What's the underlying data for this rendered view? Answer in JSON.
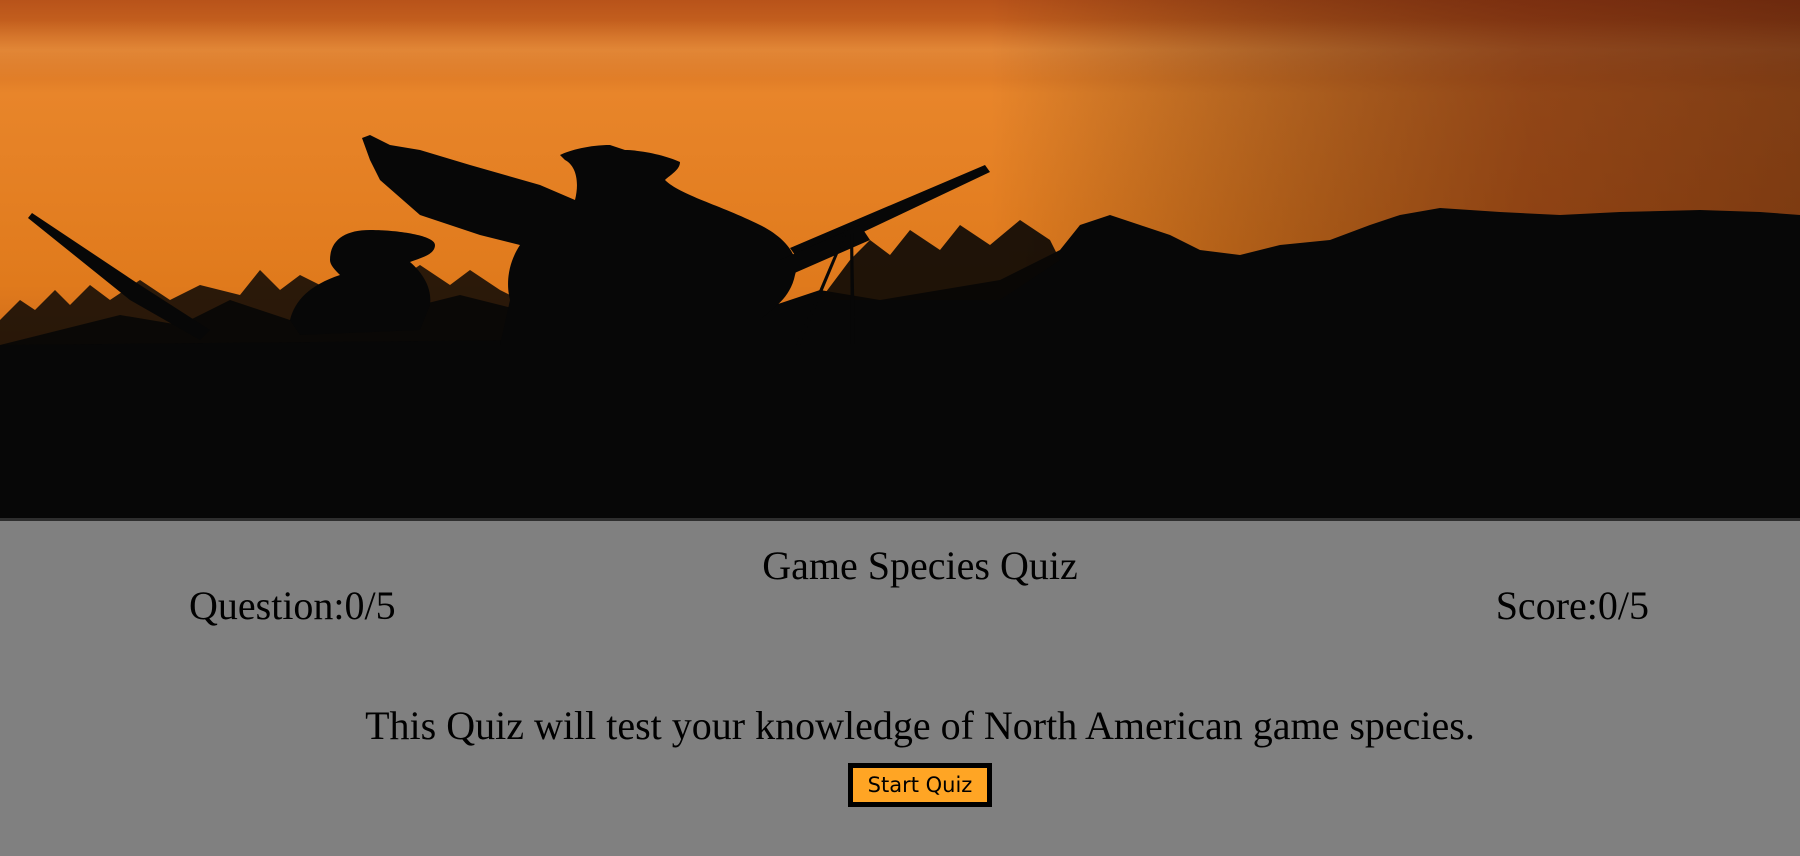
{
  "hero": {
    "image_description": "",
    "colors": {
      "sky_light": "#f0a040",
      "sky_mid": "#e07d1e",
      "sky_dark": "#7a2a12",
      "silhouette": "#070707"
    }
  },
  "quiz": {
    "title": "Game Species Quiz",
    "question_counter": "Question:0/5",
    "score_counter": "Score:0/5",
    "intro": "This Quiz will test your knowledge of North American game species.",
    "start_button_label": "Start Quiz",
    "colors": {
      "panel_background": "#808080",
      "button_background": "#ffa524",
      "button_border": "#000000"
    }
  }
}
